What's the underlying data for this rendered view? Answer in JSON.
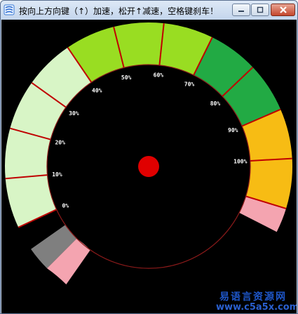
{
  "window": {
    "title": "按向上方向键（↑）加速，松开↑减速，空格键刹车！",
    "controls": {
      "minimize_icon": "minimize-icon",
      "maximize_icon": "maximize-icon",
      "close_icon": "close-icon"
    }
  },
  "gauge": {
    "scale_labels": [
      "0%",
      "10%",
      "20%",
      "30%",
      "40%",
      "50%",
      "60%",
      "70%",
      "80%",
      "90%",
      "100%"
    ],
    "needle_value_percent": 0,
    "colors": {
      "background": "#000000",
      "segment_divider": "#c00000",
      "dial_outline": "#8b1a1a",
      "hub": "#e00000",
      "low_band": "#d8f5c6",
      "mid_band_light": "#99dd22",
      "mid_band_dark": "#22aa44",
      "high_band": "#f7bc14",
      "pink_zone": "#f4a4b0",
      "gray_zone": "#7f7f7f"
    }
  },
  "watermark": {
    "line1": "易语言资源网",
    "line2": "www.c5a5x.com"
  }
}
